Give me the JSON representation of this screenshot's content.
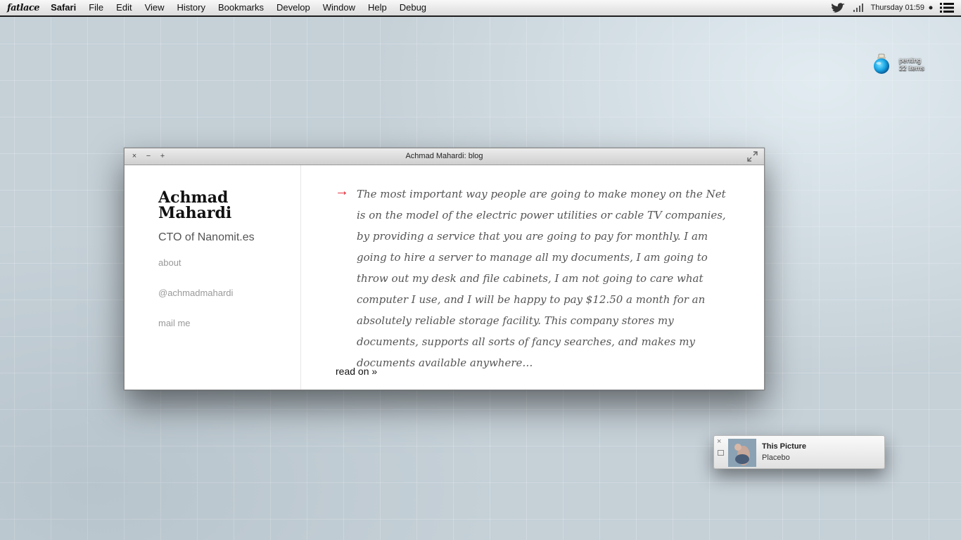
{
  "menubar": {
    "logo": "fatlace",
    "app": "Safari",
    "items": [
      "File",
      "Edit",
      "View",
      "History",
      "Bookmarks",
      "Develop",
      "Window",
      "Help",
      "Debug"
    ],
    "clock": "Thursday 01:59",
    "icons": [
      "twitter-bird-icon",
      "signal-bars-icon",
      "status-dot-icon",
      "list-menu-icon"
    ]
  },
  "desktop": {
    "item": {
      "line1": "penting",
      "line2": "22 items",
      "icon": "blue-jar-icon"
    }
  },
  "window": {
    "title": "Achmad Mahardi: blog",
    "controls": {
      "close": "×",
      "minimize": "−",
      "zoom": "+"
    },
    "sidebar": {
      "site_title": "Achmad Mahardi",
      "tagline": "CTO of Nanomit.es",
      "links": [
        "about",
        "@achmadmahardi",
        "mail me"
      ]
    },
    "post": {
      "arrow": "→",
      "quote": "The most important way people are going to make money on the Net is on the model of the electric power utilities or cable TV companies, by providing a service that you are going to pay for monthly. I am going to hire a server to manage all my documents, I am going to throw out my desk and file cabinets, I am not going to care what computer I use, and I will be happy to pay $12.50 a month for an absolutely reliable storage facility. This company stores my documents, supports all sorts of fancy searches, and makes my documents available anywhere…",
      "read_on": "read on »"
    }
  },
  "notification": {
    "title": "This Picture",
    "subtitle": "Placebo",
    "close": "×"
  },
  "colors": {
    "accent_arrow": "#e0202a",
    "desktop": "#c5d0d7"
  }
}
